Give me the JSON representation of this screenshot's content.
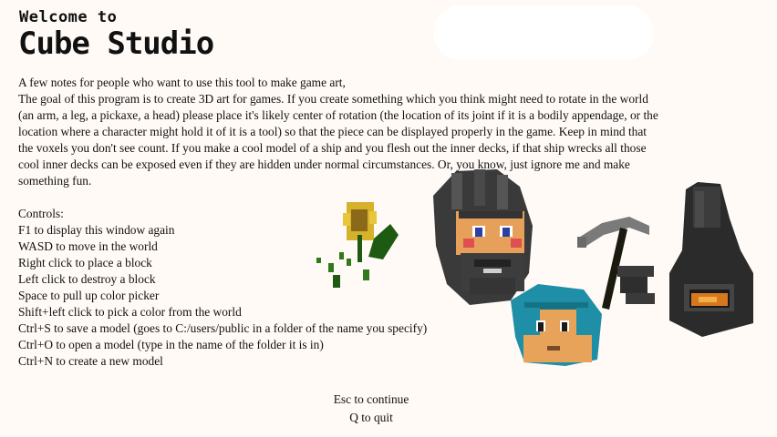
{
  "header": {
    "welcome": "Welcome to",
    "app_title": "Cube Studio"
  },
  "notes": {
    "lines": [
      "A few notes for people who want to use this tool to make game art,",
      "The goal of this program is to create 3D art for games.  If you create something which you think might need to rotate in the world",
      "(an arm, a leg, a pickaxe, a head) please place it's likely center of rotation (the location of its joint if it is a bodily appendage, or the",
      "location where a character might hold it of it is a tool)  so that the piece can be displayed properly in the game.  Keep in mind that",
      "the voxels you don't see count.  If you make a cool model of a ship and you flesh out the inner decks, if that ship wrecks all those",
      "cool inner decks can be exposed even if they are hidden under normal circumstances.  Or, you know, just ignore me and make",
      "something fun."
    ]
  },
  "controls": {
    "heading": "Controls:",
    "items": [
      "F1 to display this window again",
      "WASD to move in the world",
      "Right click to place a block",
      "Left click to destroy a block",
      "Space to pull up color picker",
      "Shift+left click to pick a color from the world",
      "Ctrl+S to save a model (goes to C:/users/public in a folder of the name you specify)",
      "Ctrl+O to open a model (type in the name of the folder it is in)",
      "Ctrl+N to create a new model"
    ]
  },
  "footer": {
    "continue": "Esc to continue",
    "quit": "Q to quit"
  },
  "art": {
    "items": [
      "voxel-sunflower-icon",
      "voxel-bearded-head-icon",
      "voxel-teal-hair-head-icon",
      "voxel-pickaxe-icon",
      "voxel-furnace-icon"
    ],
    "colors": {
      "background": "#fffaf6",
      "dark_voxel": "#2e2e2e",
      "skin": "#e8a35a",
      "teal_hair": "#1e8fa6",
      "leaf_green": "#1e5a12",
      "furnace_glow": "#d8781e"
    }
  }
}
